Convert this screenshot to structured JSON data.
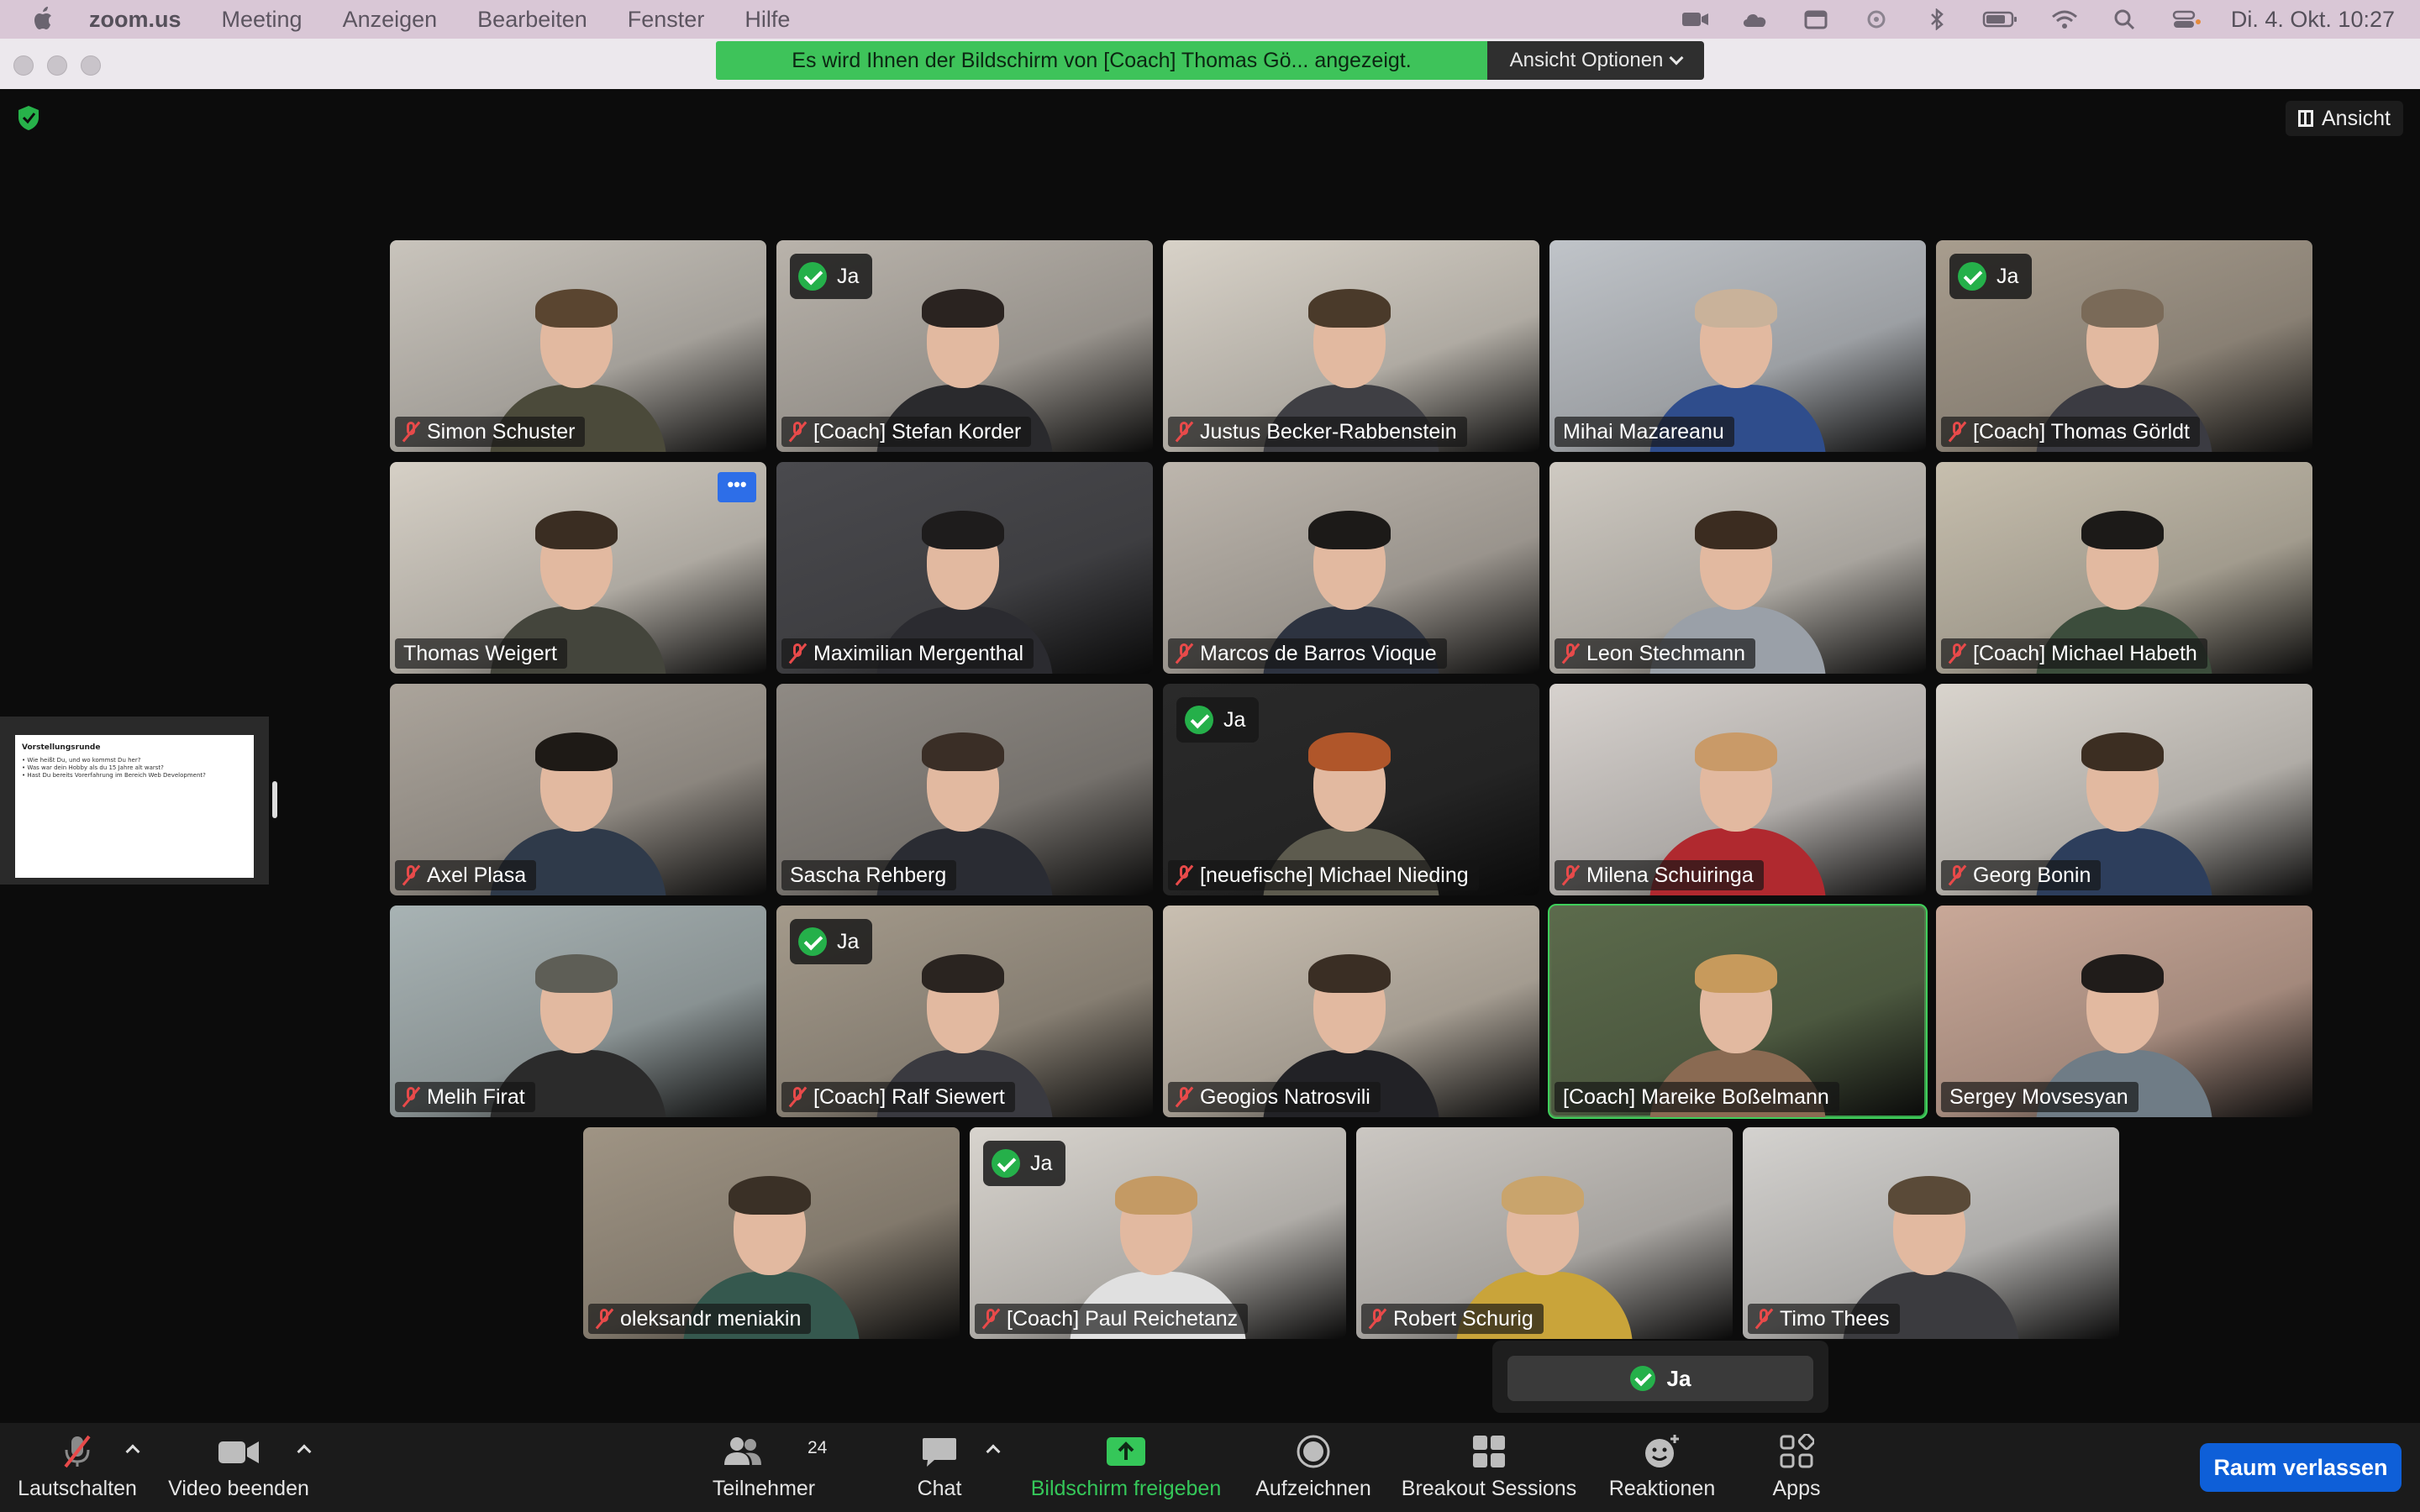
{
  "menubar": {
    "app_name": "zoom.us",
    "menus": [
      "Meeting",
      "Anzeigen",
      "Bearbeiten",
      "Fenster",
      "Hilfe"
    ],
    "clock": "Di. 4. Okt.  10:27",
    "status_icons": [
      "video-icon",
      "cloud-icon",
      "calendar-icon",
      "focus-icon",
      "bluetooth-icon",
      "battery-icon",
      "wifi-icon",
      "search-icon",
      "control-center-icon"
    ]
  },
  "window": {
    "share_banner": "Es wird Ihnen der Bildschirm von [Coach] Thomas Gö... angezeigt.",
    "view_options": "Ansicht Optionen",
    "view_button": "Ansicht"
  },
  "shared_screen": {
    "title": "Vorstellungsrunde",
    "lines": [
      "• Wie heißt Du, und wo kommst Du her?",
      "• Was war dein Hobby als du 15 Jahre alt warst?",
      "• Hast Du bereits Vorerfahrung im Bereich Web Development?"
    ]
  },
  "participants": [
    {
      "name": "Simon Schuster",
      "muted": true,
      "ja": false
    },
    {
      "name": "[Coach] Stefan Korder",
      "muted": true,
      "ja": true
    },
    {
      "name": "Justus Becker-Rabbenstein",
      "muted": true,
      "ja": false
    },
    {
      "name": "Mihai Mazareanu",
      "muted": false,
      "ja": false
    },
    {
      "name": "[Coach] Thomas Görldt",
      "muted": true,
      "ja": true
    },
    {
      "name": "Thomas Weigert",
      "muted": false,
      "ja": false,
      "more": true
    },
    {
      "name": "Maximilian Mergenthal",
      "muted": true,
      "ja": false
    },
    {
      "name": "Marcos de Barros Vioque",
      "muted": true,
      "ja": false
    },
    {
      "name": "Leon Stechmann",
      "muted": true,
      "ja": false
    },
    {
      "name": "[Coach] Michael Habeth",
      "muted": true,
      "ja": false
    },
    {
      "name": "Axel Plasa",
      "muted": true,
      "ja": false
    },
    {
      "name": "Sascha Rehberg",
      "muted": false,
      "ja": false
    },
    {
      "name": "[neuefische] Michael Nieding",
      "muted": true,
      "ja": true
    },
    {
      "name": "Milena Schuiringa",
      "muted": true,
      "ja": false
    },
    {
      "name": "Georg Bonin",
      "muted": true,
      "ja": false
    },
    {
      "name": "Melih Firat",
      "muted": true,
      "ja": false
    },
    {
      "name": "[Coach] Ralf Siewert",
      "muted": true,
      "ja": true
    },
    {
      "name": "Geogios Natrosvili",
      "muted": true,
      "ja": false
    },
    {
      "name": "[Coach] Mareike Boßelmann",
      "muted": false,
      "ja": false,
      "active": true
    },
    {
      "name": "Sergey Movsesyan",
      "muted": false,
      "ja": false
    },
    {
      "name": "oleksandr meniakin",
      "muted": true,
      "ja": false
    },
    {
      "name": "[Coach] Paul Reichetanz",
      "muted": true,
      "ja": true
    },
    {
      "name": "Robert Schurig",
      "muted": true,
      "ja": false
    },
    {
      "name": "Timo Thees",
      "muted": true,
      "ja": false
    }
  ],
  "ja_label": "Ja",
  "more_label": "•••",
  "reaction_strip": {
    "label": "Ja"
  },
  "toolbar": {
    "mute": "Lautschalten",
    "video": "Video beenden",
    "participants": "Teilnehmer",
    "participants_count": "24",
    "chat": "Chat",
    "share": "Bildschirm freigeben",
    "record": "Aufzeichnen",
    "breakout": "Breakout Sessions",
    "reactions": "Reaktionen",
    "apps": "Apps",
    "leave": "Raum verlassen"
  },
  "colors": {
    "accent_green": "#3fcf5b",
    "leave_blue": "#0e5fd8",
    "muted_red": "#e84a4a"
  }
}
